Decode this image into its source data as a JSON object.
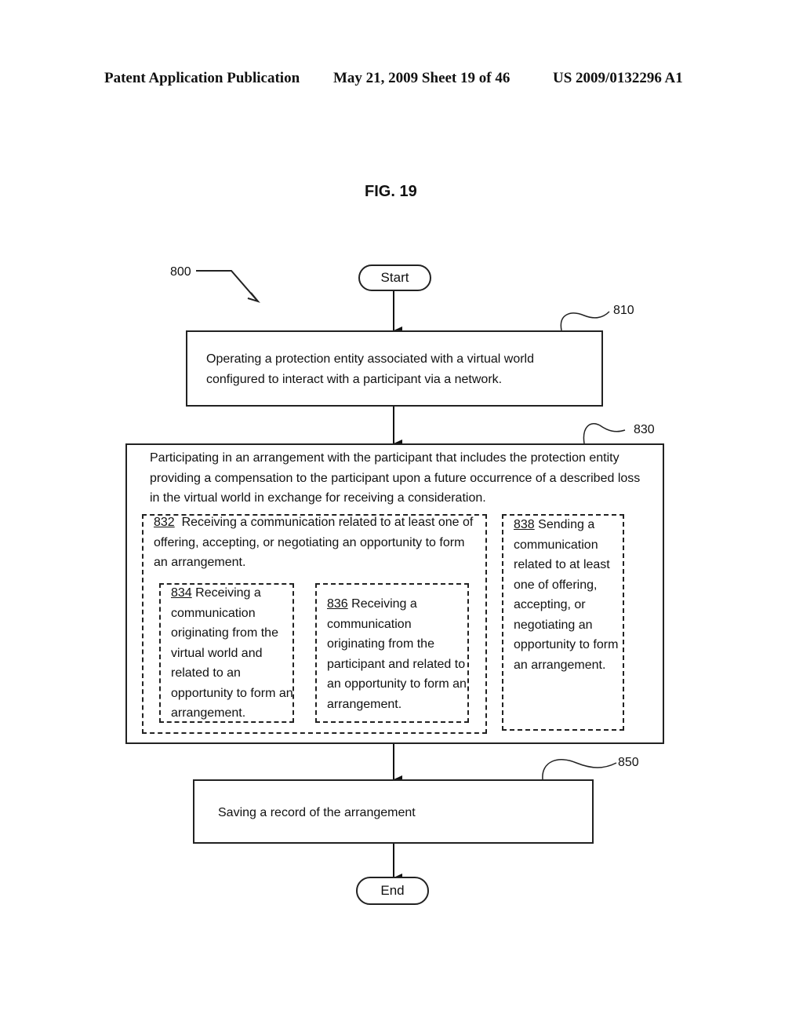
{
  "header": {
    "publication": "Patent Application Publication",
    "date_sheet": "May 21, 2009  Sheet 19 of 46",
    "number": "US 2009/0132296 A1"
  },
  "figure": {
    "title": "FIG. 19",
    "ref_label": "800"
  },
  "flowchart": {
    "start": "Start",
    "end": "End",
    "steps": [
      {
        "ref": "810",
        "text": "Operating a protection entity associated with a virtual world configured to interact with a participant via a network."
      },
      {
        "ref": "830",
        "text": "Participating in an arrangement with the participant that includes the protection entity providing a compensation to the participant upon a future occurrence of a described loss in the virtual world in exchange for receiving a consideration.",
        "substeps": [
          {
            "ref": "832",
            "text": "Receiving a communication related to at least one of offering, accepting, or negotiating an opportunity to form an arrangement.",
            "substeps": [
              {
                "ref": "834",
                "text": "Receiving a communication originating from the virtual world and related to an opportunity to form an arrangement."
              },
              {
                "ref": "836",
                "text": "Receiving a communication originating from the participant and related to an opportunity to form an arrangement."
              }
            ]
          },
          {
            "ref": "838",
            "text": "Sending a communication related to at least one of offering, accepting, or negotiating an opportunity to form an arrangement."
          }
        ]
      },
      {
        "ref": "850",
        "text": "Saving a record of the arrangement"
      }
    ]
  }
}
